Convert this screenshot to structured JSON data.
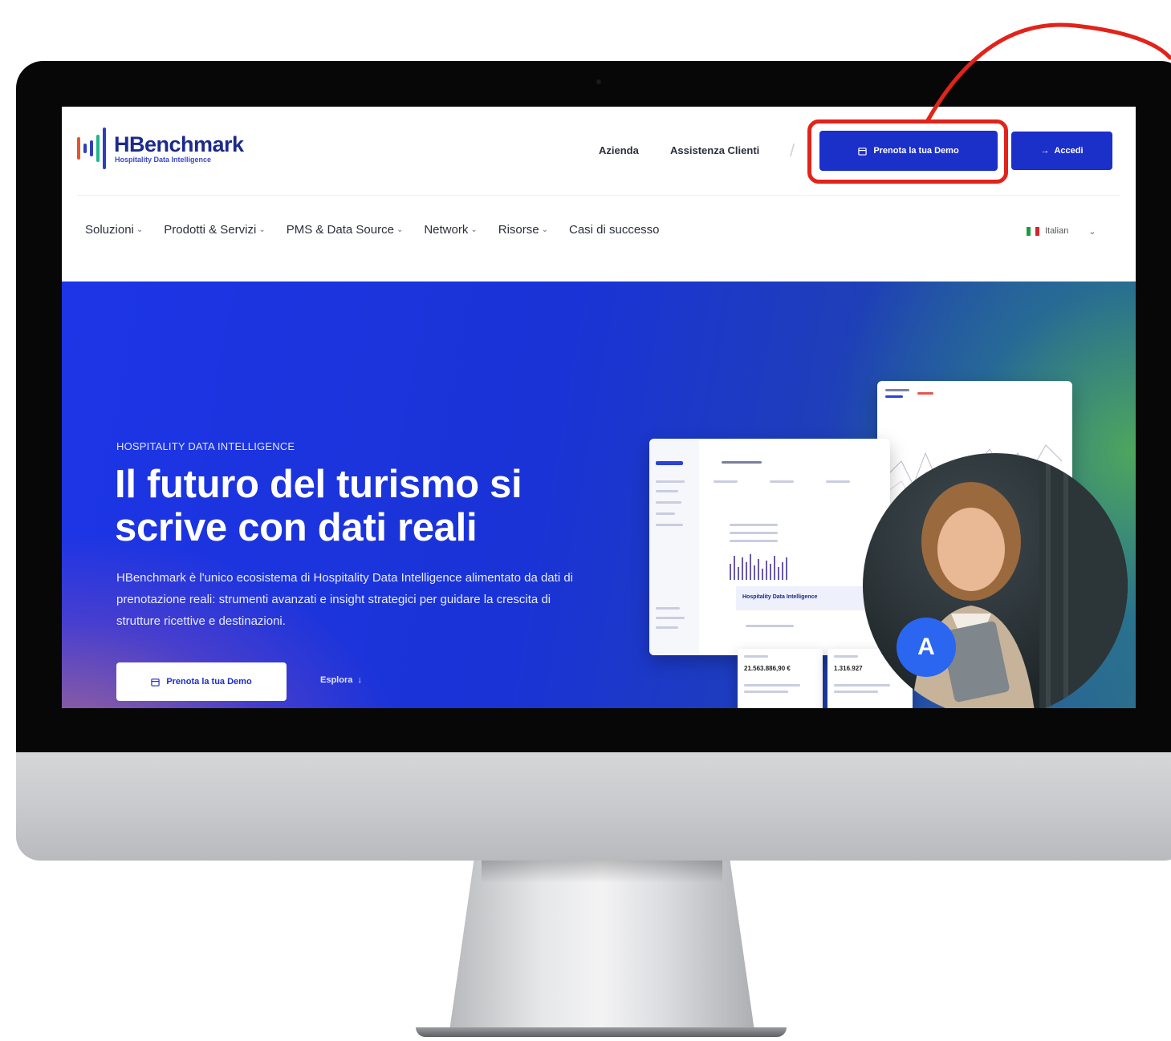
{
  "header": {
    "brand": "HBenchmark",
    "tagline": "Hospitality Data Intelligence",
    "top_links": [
      "Azienda",
      "Assistenza Clienti"
    ],
    "demo_button": "Prenota la tua Demo",
    "login_button": "Accedi",
    "icons": {
      "calendar": "calendar-icon",
      "login": "login-icon",
      "chevron": "chevron-down-icon"
    }
  },
  "nav": {
    "items": [
      {
        "label": "Soluzioni"
      },
      {
        "label": "Prodotti & Servizi"
      },
      {
        "label": "PMS & Data Source"
      },
      {
        "label": "Network"
      },
      {
        "label": "Risorse"
      },
      {
        "label": "Casi di successo"
      }
    ],
    "language": "Italian"
  },
  "hero": {
    "eyebrow": "HOSPITALITY DATA INTELLIGENCE",
    "title": "Il futuro del turismo si scrive con dati reali",
    "description": "HBenchmark è l'unico ecosistema di Hospitality Data Intelligence alimentato da dati di prenotazione reali: strumenti avanzati e insight strategici per guidare la crescita di strutture ricettive e destinazioni.",
    "demo_button": "Prenota la tua Demo",
    "explore_link": "Esplora",
    "dashboard_label": "Hospitality Data Intelligence",
    "kpi_value": "21.563.886,90 €",
    "kpi_value_2": "1.316.927",
    "avatar_letter": "A"
  },
  "colors": {
    "brand_blue": "#1b2fc9",
    "highlight_red": "#e2231a"
  }
}
